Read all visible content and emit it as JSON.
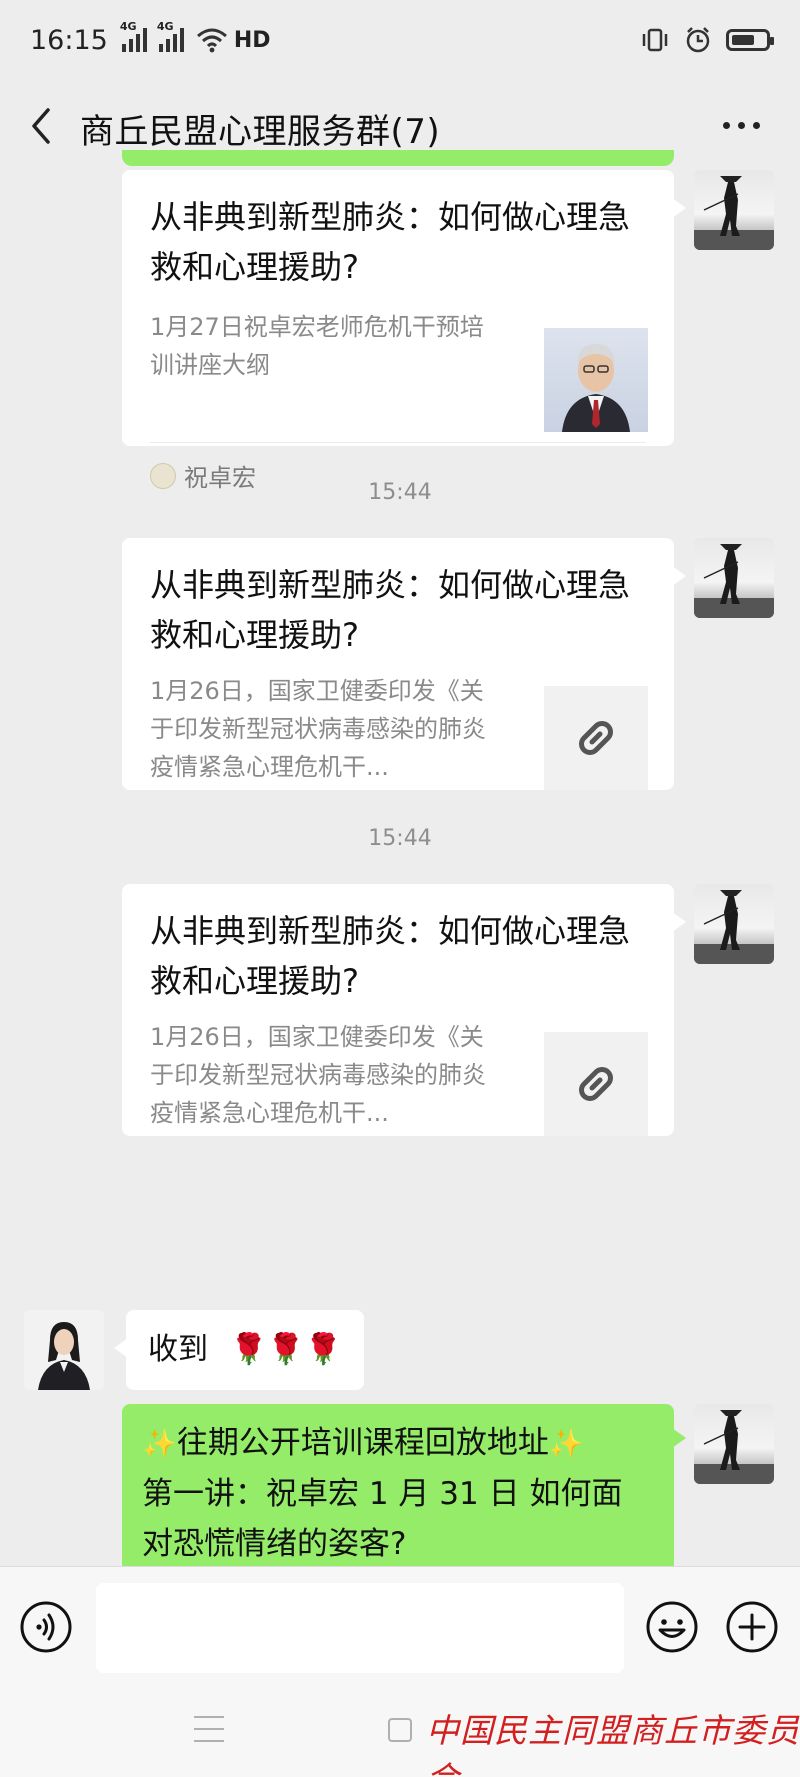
{
  "status_bar": {
    "time": "16:15",
    "network_1": "4G",
    "network_2": "4G",
    "hd": "HD"
  },
  "header": {
    "back_icon": "chevron-left-icon",
    "title": "商丘民盟心理服务群(7)",
    "more_icon": "more-dots-icon"
  },
  "messages": [
    {
      "type": "link_card",
      "side": "right",
      "title": "从非典到新型肺炎：如何做心理急救和心理援助?",
      "description": "1月27日祝卓宏老师危机干预培训讲座大纲",
      "thumbnail": "portrait-photo",
      "source": "祝卓宏"
    },
    {
      "type": "timestamp",
      "text": "15:44"
    },
    {
      "type": "link_card",
      "side": "right",
      "title": "从非典到新型肺炎：如何做心理急救和心理援助?",
      "description": "1月26日，国家卫健委印发《关于印发新型冠状病毒感染的肺炎疫情紧急心理危机干...",
      "thumbnail": "link-icon"
    },
    {
      "type": "timestamp",
      "text": "15:44"
    },
    {
      "type": "link_card",
      "side": "right",
      "title": "从非典到新型肺炎：如何做心理急救和心理援助?",
      "description": "1月26日，国家卫健委印发《关于印发新型冠状病毒感染的肺炎疫情紧急心理危机干...",
      "thumbnail": "link-icon"
    },
    {
      "type": "text",
      "side": "left",
      "text": "收到",
      "emoji": "🌹🌹🌹"
    },
    {
      "type": "text",
      "side": "right",
      "color": "#95ec69",
      "line1": "往期公开培训课程回放地址",
      "line2": "第一讲：祝卓宏 1 月 31 日 如何面",
      "line3": "对恐慌情绪的姿客?"
    }
  ],
  "input_bar": {
    "voice_icon": "voice-icon",
    "emoji_icon": "emoji-icon",
    "plus_icon": "plus-icon",
    "value": ""
  },
  "watermark": "中国民主同盟商丘市委员会",
  "colors": {
    "chat_background": "#ededed",
    "bubble_green": "#95ec69",
    "bubble_white": "#ffffff",
    "watermark_red": "#d21f1f"
  }
}
